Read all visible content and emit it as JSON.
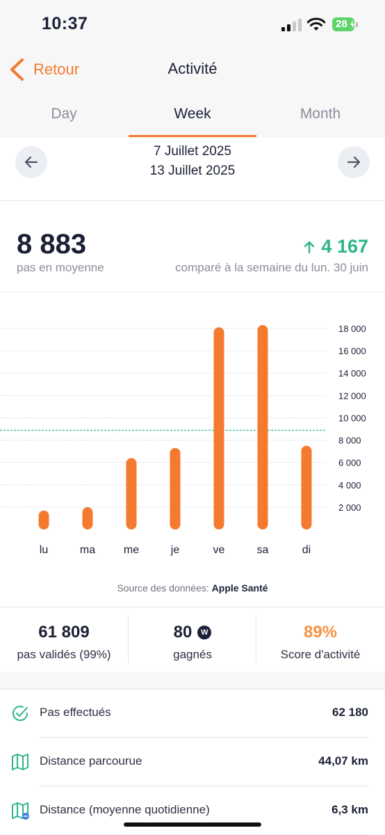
{
  "status": {
    "time": "10:37",
    "battery": "28"
  },
  "nav": {
    "back_label": "Retour",
    "title": "Activité"
  },
  "tabs": [
    {
      "label": "Day",
      "active": false
    },
    {
      "label": "Week",
      "active": true
    },
    {
      "label": "Month",
      "active": false
    }
  ],
  "date_range": {
    "start": "7 Juillet 2025",
    "end": "13 Juillet 2025"
  },
  "summary": {
    "average_steps": "8 883",
    "average_label": "pas en moyenne",
    "delta": "4 167",
    "comparison_label": "comparé à la semaine du lun. 30 juin"
  },
  "chart_data": {
    "type": "bar",
    "categories": [
      "lu",
      "ma",
      "me",
      "je",
      "ve",
      "sa",
      "di"
    ],
    "values": [
      1700,
      2000,
      6400,
      7300,
      18100,
      18300,
      7500
    ],
    "ylim": [
      0,
      18000
    ],
    "yticks": [
      2000,
      4000,
      6000,
      8000,
      10000,
      12000,
      14000,
      16000,
      18000
    ],
    "ytick_labels": [
      "2 000",
      "4 000",
      "6 000",
      "8 000",
      "10 000",
      "12 000",
      "14 000",
      "16 000",
      "18 000"
    ],
    "average_line": 8883,
    "grid": true,
    "bar_color": "#f47a2f",
    "average_line_color": "#45c4b0"
  },
  "source": {
    "prefix": "Source des données:",
    "name": "Apple Santé"
  },
  "stats": [
    {
      "value": "61 809",
      "label": "pas validés (99%)",
      "color": "#1b2036"
    },
    {
      "value": "80",
      "label": "gagnés",
      "color": "#1b2036",
      "icon": "W"
    },
    {
      "value": "89%",
      "label": "Score d'activité",
      "color": "#f5923e"
    }
  ],
  "details": [
    {
      "icon": "check-circle-icon",
      "label": "Pas effectués",
      "value": "62 180"
    },
    {
      "icon": "map-icon",
      "label": "Distance parcourue",
      "value": "44,07 km"
    },
    {
      "icon": "map-average-icon",
      "label": "Distance (moyenne quotidienne)",
      "value": "6,3 km"
    }
  ],
  "colors": {
    "accent": "#f47a2f",
    "positive": "#2cb48a",
    "text": "#1b2036",
    "muted": "#8b8e99"
  }
}
